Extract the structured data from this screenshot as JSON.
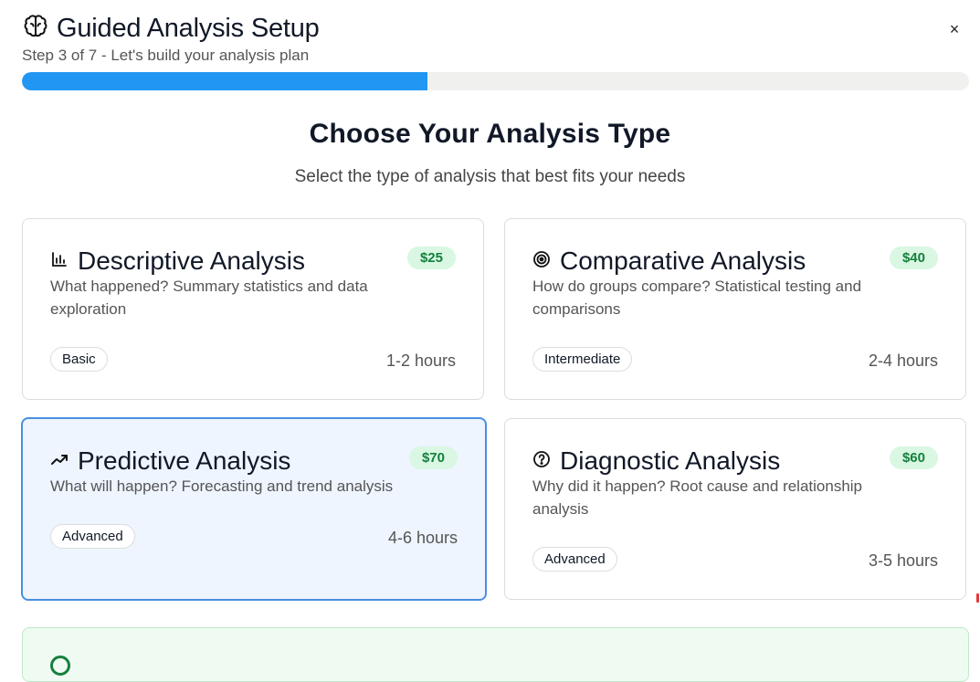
{
  "header": {
    "title": "Guided Analysis Setup",
    "subtitle": "Step 3 of 7 - Let's build your analysis plan",
    "close_label": "×",
    "icon": "brain-icon"
  },
  "progress": {
    "fraction": 0.4286,
    "accent": "#2196f3"
  },
  "section": {
    "title": "Choose Your Analysis Type",
    "subtitle": "Select the type of analysis that best fits your needs"
  },
  "cards": [
    {
      "icon": "bar-chart-icon",
      "name": "Descriptive Analysis",
      "price": "$25",
      "description": "What happened? Summary statistics and data exploration",
      "level": "Basic",
      "time": "1-2 hours",
      "selected": false
    },
    {
      "icon": "target-icon",
      "name": "Comparative Analysis",
      "price": "$40",
      "description": "How do groups compare? Statistical testing and comparisons",
      "level": "Intermediate",
      "time": "2-4 hours",
      "selected": false
    },
    {
      "icon": "trending-up-icon",
      "name": "Predictive Analysis",
      "price": "$70",
      "description": "What will happen? Forecasting and trend analysis",
      "level": "Advanced",
      "time": "4-6 hours",
      "selected": true
    },
    {
      "icon": "help-circle-icon",
      "name": "Diagnostic Analysis",
      "price": "$60",
      "description": "Why did it happen? Root cause and relationship analysis",
      "level": "Advanced",
      "time": "3-5 hours",
      "selected": false
    }
  ],
  "colors": {
    "price_bg": "#d9f7e2",
    "price_text": "#15803d",
    "selected_bg": "#eef5ff",
    "selected_border": "#4a8fe0"
  }
}
